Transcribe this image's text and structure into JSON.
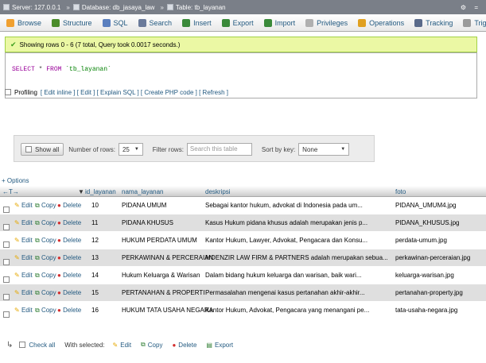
{
  "topbar": {
    "server": "Server: 127.0.0.1",
    "database": "Database: db_jasaya_law",
    "table": "Table: tb_layanan",
    "controls": "⚙ ="
  },
  "tabs": [
    {
      "label": "Browse",
      "color": "#f0a030"
    },
    {
      "label": "Structure",
      "color": "#4a8c2a"
    },
    {
      "label": "SQL",
      "color": "#5a7fbf"
    },
    {
      "label": "Search",
      "color": "#6a7a9a"
    },
    {
      "label": "Insert",
      "color": "#3a8a3a"
    },
    {
      "label": "Export",
      "color": "#3a8a3a"
    },
    {
      "label": "Import",
      "color": "#3a8a3a"
    },
    {
      "label": "Privileges",
      "color": "#b0b0b0"
    },
    {
      "label": "Operations",
      "color": "#e0a020"
    },
    {
      "label": "Tracking",
      "color": "#5a6a8a"
    },
    {
      "label": "Triggers",
      "color": "#9a9a9a"
    }
  ],
  "success_message": "Showing rows 0 - 6 (7 total, Query took 0.0017 seconds.)",
  "sql": {
    "select": "SELECT",
    "star": " * ",
    "from": "FROM",
    "table": " `tb_layanan`"
  },
  "profiling": {
    "label": "Profiling",
    "links": "[ Edit inline ] [ Edit ] [ Explain SQL ] [ Create PHP code ] [ Refresh ]"
  },
  "nav": {
    "show_all": "Show all",
    "number_of_rows_label": "Number of rows:",
    "number_of_rows_value": "25",
    "filter_rows_label": "Filter rows:",
    "filter_placeholder": "Search this table",
    "sort_by_key_label": "Sort by key:",
    "sort_by_key_value": "None"
  },
  "options_label": "+ Options",
  "table": {
    "nav_arrows": "←T→",
    "columns": [
      "id_layanan",
      "nama_layanan",
      "deskripsi",
      "foto"
    ],
    "sort_marker": "▼",
    "actions": {
      "edit": "Edit",
      "copy": "Copy",
      "delete": "Delete"
    },
    "rows": [
      {
        "id": "10",
        "nama": "PIDANA UMUM",
        "deskripsi": "Sebagai kantor hukum, advokat di Indonesia pada um...",
        "foto": "PIDANA_UMUM4.jpg",
        "delete_label": "Delete"
      },
      {
        "id": "11",
        "nama": "PIDANA KHUSUS",
        "deskripsi": "Kasus Hukum pidana khusus adalah merupakan jenis p...",
        "foto": "PIDANA_KHUSUS.jpg",
        "delete_label": "Delete"
      },
      {
        "id": "12",
        "nama": "HUKUM PERDATA UMUM",
        "deskripsi": "Kantor Hukum, Lawyer, Advokat, Pengacara dan Konsu...",
        "foto": "perdata-umum.jpg",
        "delete_label": "Delete"
      },
      {
        "id": "13",
        "nama": "PERKAWINAN & PERCERAIAN",
        "deskripsi": "MOENZIR LAW FIRM & PARTNERS adalah merupakan sebua...",
        "foto": "perkawinan-perceraian.jpg",
        "delete_label": "Delete"
      },
      {
        "id": "14",
        "nama": "Hukum Keluarga & Warisan",
        "deskripsi": "Dalam bidang hukum keluarga dan warisan, baik wari...",
        "foto": "keluarga-warisan.jpg",
        "delete_label": "Delete"
      },
      {
        "id": "15",
        "nama": "PERTANAHAN & PROPERTI",
        "deskripsi": "Permasalahan mengenai kasus pertanahan akhir-akhir...",
        "foto": "pertanahan-property.jpg",
        "delete_label": "Delete"
      },
      {
        "id": "16",
        "nama": "HUKUM TATA USAHA NEGARA",
        "deskripsi": "Kantor Hukum, Advokat, Pengacara yang menangani pe...",
        "foto": "tata-usaha-negara.jpg",
        "delete_label": "Delete"
      }
    ]
  },
  "footer": {
    "check_all": "Check all",
    "with_selected": "With selected:",
    "edit": "Edit",
    "copy": "Copy",
    "delete": "Delete",
    "export": "Export"
  }
}
